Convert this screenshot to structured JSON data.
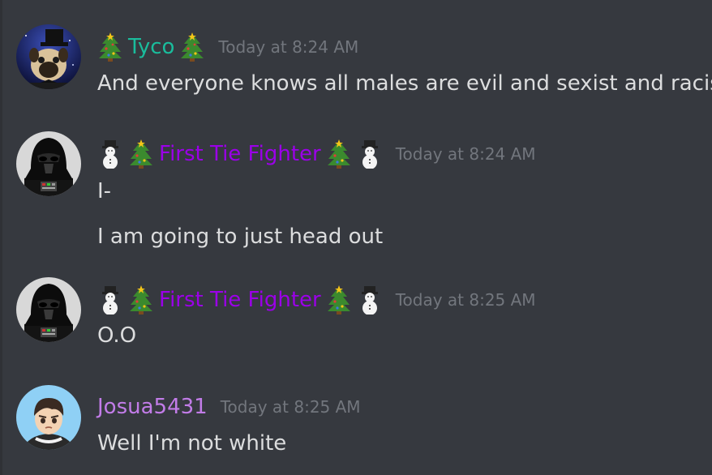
{
  "messages": [
    {
      "author": "Tyco",
      "author_color": "#1abc9c",
      "decoration_before": [
        "christmas-tree"
      ],
      "decoration_after": [
        "christmas-tree"
      ],
      "timestamp": "Today at 8:24 AM",
      "avatar": "pug-top-hat-avatar",
      "lines": [
        "And everyone knows all males are evil and sexist and racist"
      ]
    },
    {
      "author": "First Tie Fighter",
      "author_color": "#9b00e8",
      "decoration_before": [
        "snowman",
        "christmas-tree"
      ],
      "decoration_after": [
        "christmas-tree",
        "snowman"
      ],
      "timestamp": "Today at 8:24 AM",
      "avatar": "darth-vader-avatar",
      "lines": [
        "I-",
        "I am going to just head out"
      ]
    },
    {
      "author": "First Tie Fighter",
      "author_color": "#9b00e8",
      "decoration_before": [
        "snowman",
        "christmas-tree"
      ],
      "decoration_after": [
        "christmas-tree",
        "snowman"
      ],
      "timestamp": "Today at 8:25 AM",
      "avatar": "darth-vader-avatar",
      "lines": [
        "O.O"
      ]
    },
    {
      "author": "Josua5431",
      "author_color": "#c27ce8",
      "decoration_before": [],
      "decoration_after": [],
      "timestamp": "Today at 8:25 AM",
      "avatar": "cartoon-boy-headphones-avatar",
      "lines": [
        "Well I'm not white"
      ]
    }
  ],
  "colors": {
    "background": "#36393f",
    "message_text": "#dcddde",
    "timestamp": "#72767d"
  }
}
